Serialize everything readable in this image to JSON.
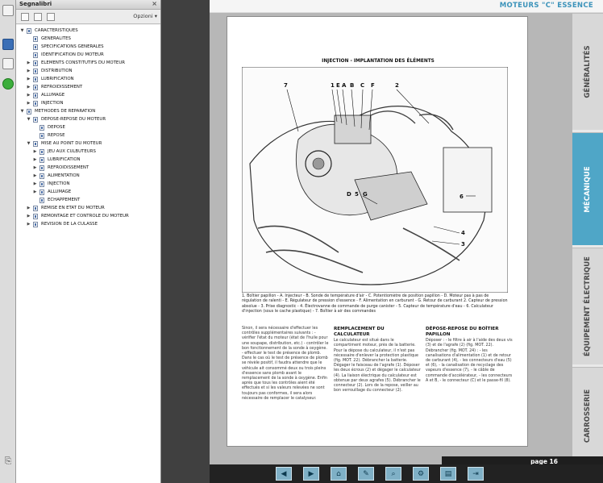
{
  "bookmarks_panel": {
    "title": "Segnalibri",
    "close_label": "×",
    "options_label": "Opzioni ▾"
  },
  "tree": [
    {
      "label": "CARACTERISTIQUES",
      "level": 0,
      "toggle": "▼"
    },
    {
      "label": "GENERALITES",
      "level": 1,
      "toggle": ""
    },
    {
      "label": "SPECIFICATIONS GENERALES",
      "level": 1,
      "toggle": ""
    },
    {
      "label": "IDENTIFICATION DU MOTEUR",
      "level": 1,
      "toggle": ""
    },
    {
      "label": "ELEMENTS CONSTITUTIFS DU MOTEUR",
      "level": 1,
      "toggle": "▶"
    },
    {
      "label": "DISTRIBUTION",
      "level": 1,
      "toggle": "▶"
    },
    {
      "label": "LUBRIFICATION",
      "level": 1,
      "toggle": "▶"
    },
    {
      "label": "REFROIDISSEMENT",
      "level": 1,
      "toggle": "▶"
    },
    {
      "label": "ALLUMAGE",
      "level": 1,
      "toggle": "▶"
    },
    {
      "label": "INJECTION",
      "level": 1,
      "toggle": "▶"
    },
    {
      "label": "METHODES DE REPARATION",
      "level": 0,
      "toggle": "▼"
    },
    {
      "label": "DEPOSE-REPOSE DU MOTEUR",
      "level": 1,
      "toggle": "▼"
    },
    {
      "label": "DEPOSE",
      "level": 2,
      "toggle": ""
    },
    {
      "label": "REPOSE",
      "level": 2,
      "toggle": ""
    },
    {
      "label": "MISE AU POINT DU MOTEUR",
      "level": 1,
      "toggle": "▼"
    },
    {
      "label": "JEU AUX CULBUTEURS",
      "level": 2,
      "toggle": "▶"
    },
    {
      "label": "LUBRIFICATION",
      "level": 2,
      "toggle": "▶"
    },
    {
      "label": "REFROIDISSEMENT",
      "level": 2,
      "toggle": "▶"
    },
    {
      "label": "ALIMENTATION",
      "level": 2,
      "toggle": "▶"
    },
    {
      "label": "INJECTION",
      "level": 2,
      "toggle": "▶"
    },
    {
      "label": "ALLUMAGE",
      "level": 2,
      "toggle": "▶"
    },
    {
      "label": "ECHAPPEMENT",
      "level": 2,
      "toggle": ""
    },
    {
      "label": "REMISE EN ETAT DU MOTEUR",
      "level": 1,
      "toggle": "▶"
    },
    {
      "label": "REMONTAGE ET CONTROLE DU MOTEUR",
      "level": 1,
      "toggle": "▶"
    },
    {
      "label": "REVISION DE LA CULASSE",
      "level": 1,
      "toggle": "▶"
    }
  ],
  "document": {
    "header": "MOTEURS \"C\" ESSENCE",
    "tabs": [
      "GÉNÉRALITÉS",
      "MÉCANIQUE",
      "ÉQUIPEMENT ÉLECTRIQUE",
      "CARROSSERIE"
    ],
    "active_tab": "MÉCANIQUE",
    "illustration_title": "INJECTION - IMPLANTATION DES ÉLÉMENTS",
    "callouts": [
      "7",
      "1",
      "E",
      "A",
      "B",
      "C",
      "F",
      "2",
      "D",
      "5",
      "G",
      "6",
      "4",
      "3"
    ],
    "legend": "1. Boîtier papillon - A. Injecteur - B. Sonde de température d'air - C. Potentiomètre de position papillon - D. Moteur pas à pas de régulation de ralenti - E. Régulateur de pression d'essence - F. Alimentation en carburant - G. Retour de carburant 2. Capteur de pression absolue - 3. Prise diagnostic - 4. Électrovanne de commande de purge canister - 5. Capteur de température d'eau - 6. Calculateur d'injection (sous le cache plastique) - 7. Boîtier à air des commandes",
    "col1_text": "Sinon, il sera nécessaire d'effectuer les contrôles supplémentaires suivants : - vérifier l'état du moteur (état de l'huile pour une soupape, distribution, etc.) - contrôler le bon fonctionnement de la sonde à oxygène. - effectuer le test de présence de plomb. Dans le cas où le test de présence de plomb se révèle positif, il faudra attendre que le véhicule ait consommé deux ou trois pleins d'essence sans plomb avant le remplacement de la sonde à oxygène. Enfin après que tous les contrôles aient été effectués et si les valeurs relevées ne sont toujours pas conformes, il sera alors nécessaire de remplacer le catalyseur.",
    "col2_title": "REMPLACEMENT DU CALCULATEUR",
    "col2_text": "Le calculateur est situé dans le compartiment moteur, près de la batterie. Pour la dépose du calculateur, il n'est pas nécessaire d'enlever la protection plastique (fig. MOT. 22). Débrancher la batterie. Dégager le faisceau de l'agrafe (1). Déposer les deux écrous (2) et dégager le calculateur (4). La liaison électrique du calculateur est obtenue par deux agrafes (5). Débrancher le connecteur (2). Lors de la repose, veiller au bon verrouillage du connecteur (2).",
    "col3_title": "DÉPOSE-REPOSE DU BOÎTIER PAPILLON",
    "col3_text": "Déposer : - le filtre à air à l'aide des deux vis (3) et de l'agrafe (2) (fig. MOT. 22). Débrancher (fig. MOT. 24) : - les canalisations d'alimentation (1) et de retour de carburant (4), - les connecteurs d'eau (5) et (6), - la canalisation de recyclage des vapeurs d'essence (7), - le câble de commande d'accélérateur, - les connecteurs A et B, - le connecteur (C) et le passe-fil (8).",
    "page_number": "page 16"
  },
  "navbar": {
    "buttons": [
      "◀",
      "▶",
      "⌂",
      "✎",
      "⌕",
      "⚙",
      "▤",
      "⇥"
    ]
  },
  "toolstrip": {
    "icons": [
      "page-icon",
      "bookmarks-icon",
      "annotate-icon",
      "attach-icon",
      "paperclip-icon"
    ]
  }
}
